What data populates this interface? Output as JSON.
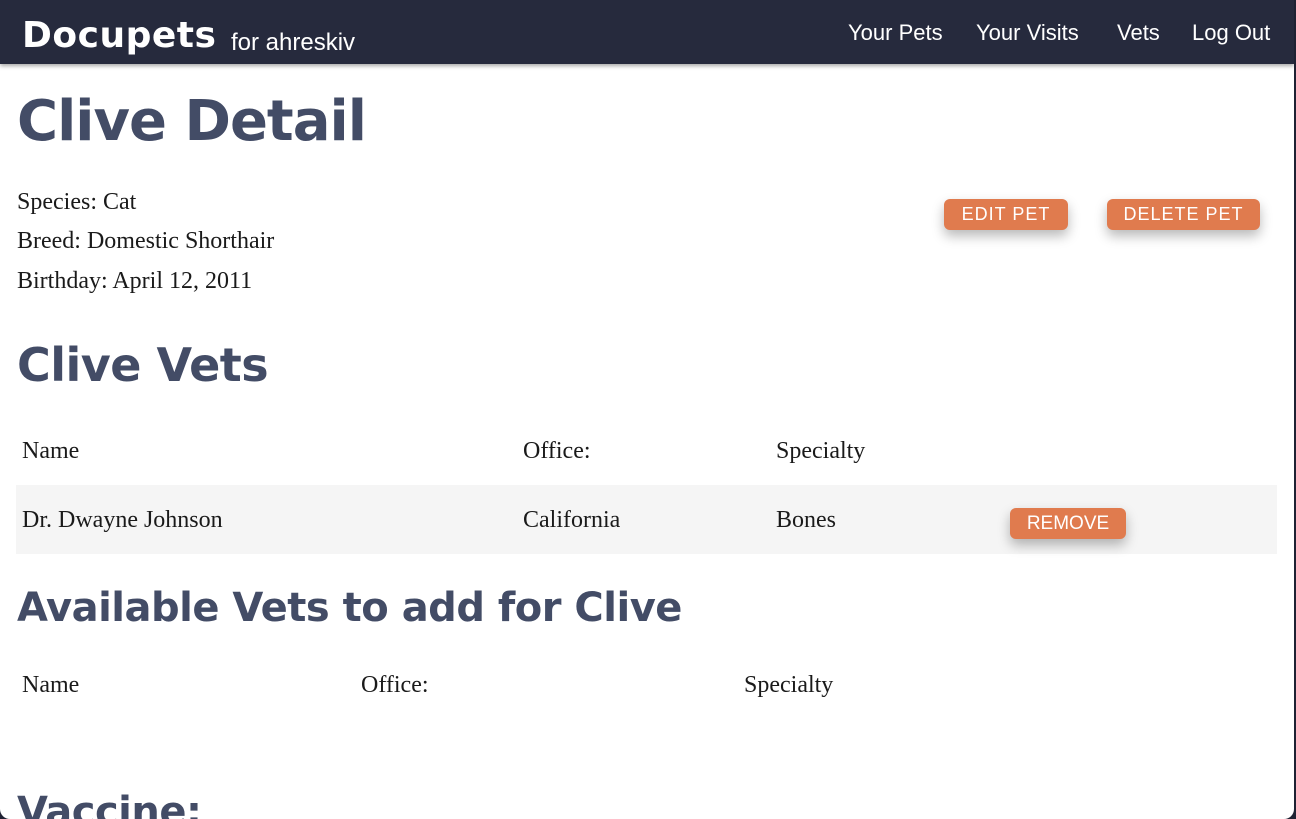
{
  "nav": {
    "brand": "Docupets",
    "user": "for ahreskiv",
    "links": [
      "Your Pets",
      "Your Visits",
      "Vets",
      "Log Out"
    ]
  },
  "pet": {
    "title": "Clive Detail",
    "species": "Species: Cat",
    "breed": "Breed: Domestic Shorthair",
    "birthday": "Birthday: April 12, 2011",
    "edit_label": "EDIT PET",
    "delete_label": "DELETE PET"
  },
  "vets_section": {
    "title": "Clive Vets",
    "headers": [
      "Name",
      "Office:",
      "Specialty"
    ],
    "rows": [
      {
        "name": "Dr. Dwayne Johnson",
        "office": "California",
        "specialty": "Bones",
        "action": "REMOVE"
      }
    ]
  },
  "available_section": {
    "title": "Available Vets to add for Clive",
    "headers": [
      "Name",
      "Office:",
      "Specialty"
    ]
  },
  "vaccine_section": {
    "title": "Vaccine:"
  },
  "colors": {
    "navbar": "#262a3d",
    "heading": "#434c66",
    "accent": "#e07b4e"
  }
}
